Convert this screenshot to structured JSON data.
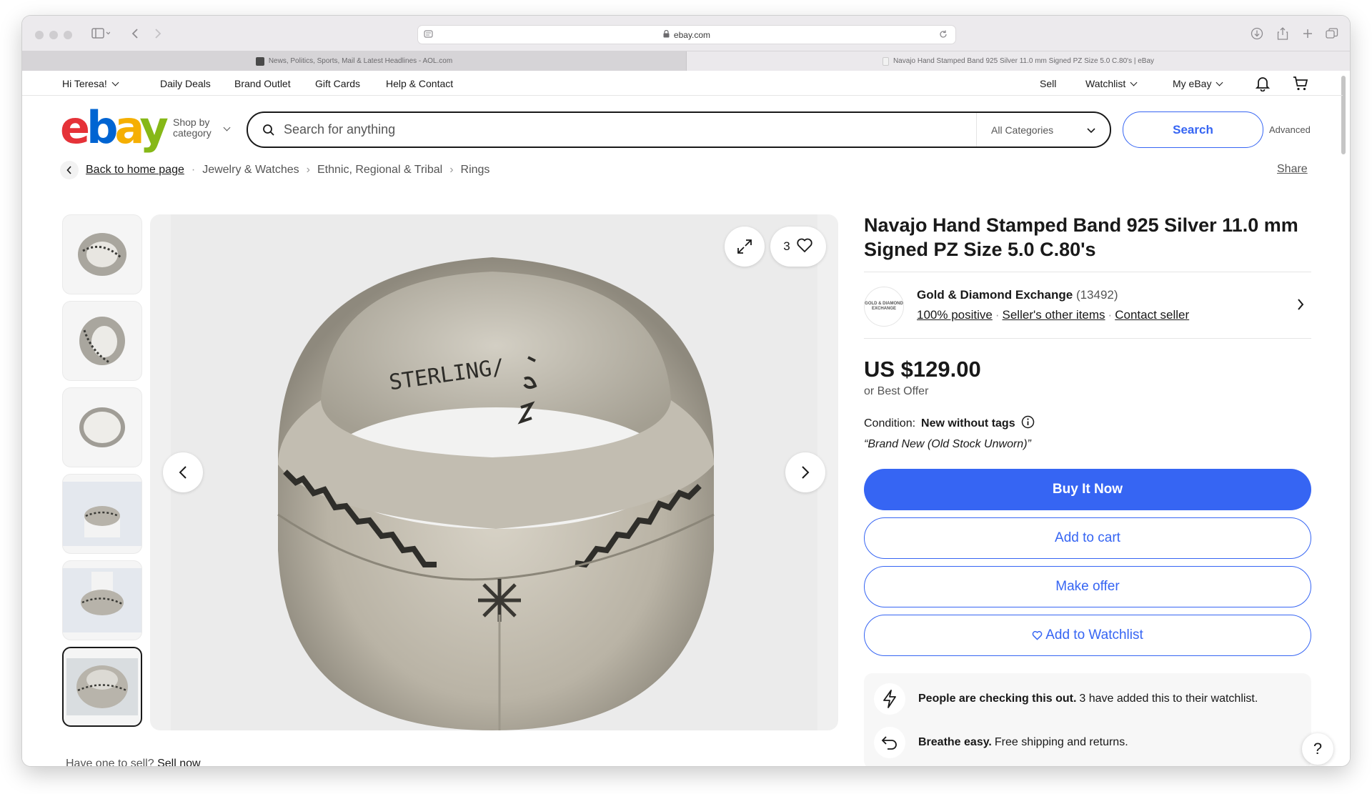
{
  "browser": {
    "url": "ebay.com",
    "tabs": [
      {
        "title": "News, Politics, Sports, Mail & Latest Headlines - AOL.com",
        "active": false,
        "favicon": "aol-icon"
      },
      {
        "title": "Navajo Hand Stamped Band 925 Silver 11.0 mm Signed PZ Size 5.0 C.80's | eBay",
        "active": true,
        "favicon": "ebay-icon"
      }
    ]
  },
  "topnav": {
    "greeting": "Hi Teresa!",
    "daily_deals": "Daily Deals",
    "brand_outlet": "Brand Outlet",
    "gift_cards": "Gift Cards",
    "help_contact": "Help & Contact",
    "sell": "Sell",
    "watchlist": "Watchlist",
    "my_ebay": "My eBay"
  },
  "header": {
    "logo": {
      "e": "e",
      "b": "b",
      "a": "a",
      "y": "y"
    },
    "logo_colors": {
      "e": "#e53238",
      "b": "#0064d2",
      "a": "#f5af02",
      "y": "#86b817"
    },
    "shop_by_line1": "Shop by",
    "shop_by_line2": "category",
    "search_placeholder": "Search for anything",
    "category_select": "All Categories",
    "search_button": "Search",
    "advanced": "Advanced"
  },
  "breadcrumb": {
    "back": "Back to home page",
    "items": [
      "Jewelry & Watches",
      "Ethnic, Regional & Tribal",
      "Rings"
    ],
    "share": "Share"
  },
  "gallery": {
    "thumbnail_count": 6,
    "selected_index": 6,
    "watch_count": "3",
    "image_stamp_text": "STERLING/"
  },
  "sell_prompt": {
    "text": "Have one to sell?",
    "link": "Sell now"
  },
  "listing": {
    "title": "Navajo Hand Stamped Band 925 Silver 11.0 mm Signed PZ Size 5.0 C.80's",
    "seller": {
      "name": "Gold & Diamond Exchange",
      "feedback_count": "(13492)",
      "logo_text": "GOLD & DIAMOND EXCHANGE",
      "positive": "100% positive",
      "other_items": "Seller's other items",
      "contact": "Contact seller"
    },
    "price": "US $129.00",
    "best_offer": "or Best Offer",
    "condition_label": "Condition:",
    "condition_value": "New without tags",
    "condition_quote": "“Brand New (Old Stock Unworn)”",
    "buttons": {
      "buy_now": "Buy It Now",
      "add_to_cart": "Add to cart",
      "make_offer": "Make offer",
      "add_to_watchlist": "Add to Watchlist"
    },
    "signals": [
      {
        "bold": "People are checking this out.",
        "text": "3 have added this to their watchlist."
      },
      {
        "bold": "Breathe easy.",
        "text": "Free shipping and returns."
      }
    ]
  },
  "colors": {
    "primary_blue": "#3665f3",
    "text": "#191919",
    "muted": "#555555"
  }
}
